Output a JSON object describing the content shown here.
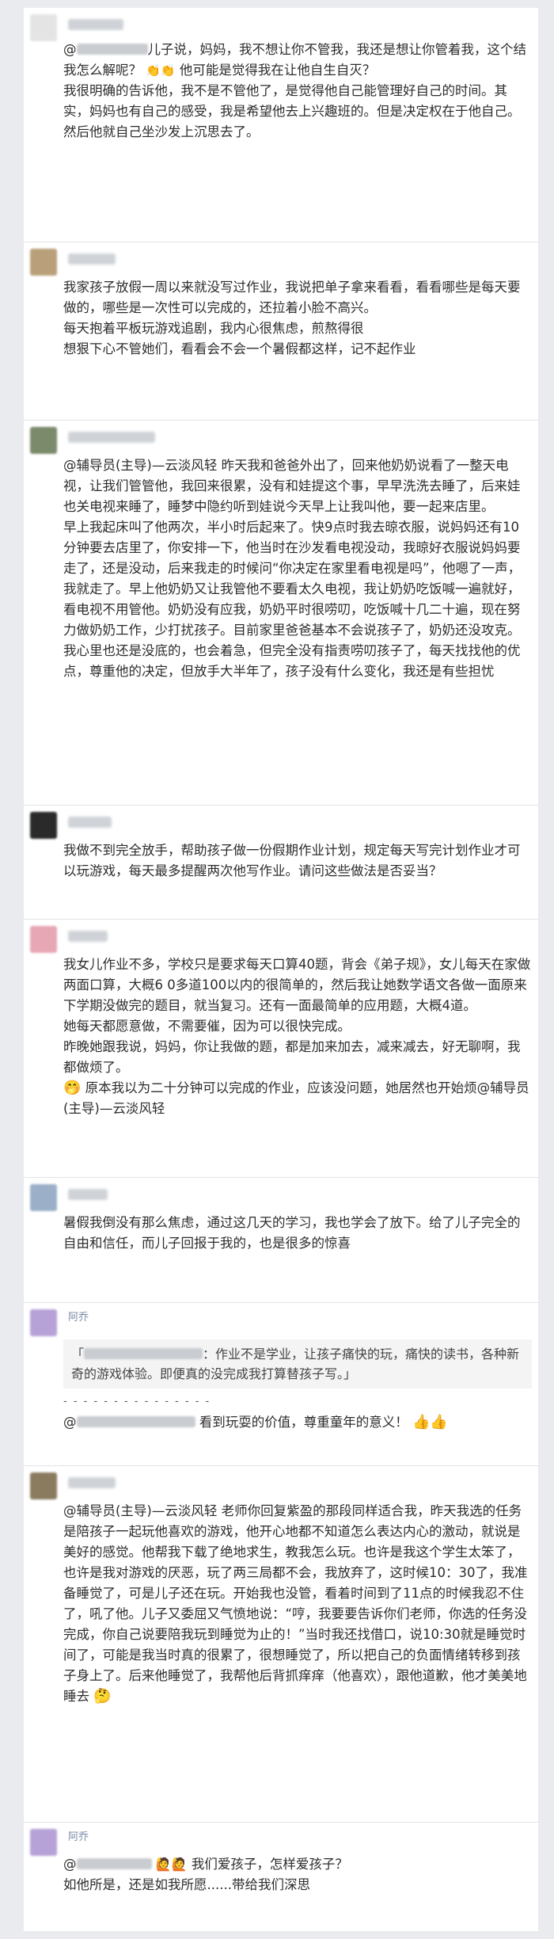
{
  "posts": [
    {
      "avatar_color": "#e4e4e4",
      "paragraphs": [
        "儿子说，妈妈，我不想让你不管我，我还是想让你管着我，这个结我怎么解呢？",
        "他可能是觉得我在让他自生自灭？",
        "我很明确的告诉他，我不是不管他了，是觉得他自己能管理好自己的时间。其实，妈妈也有自己的感受，我是希望他去上兴趣班的。但是决定权在于他自己。",
        "然后他就自己坐沙发上沉思去了。"
      ]
    },
    {
      "avatar_color": "#b9a07a",
      "paragraphs": [
        "我家孩子放假一周以来就没写过作业，我说把单子拿来看看，看看哪些是每天要做的，哪些是一次性可以完成的，还拉着小脸不高兴。",
        "每天抱着平板玩游戏追剧，我内心很焦虑，煎熬得很",
        "想狠下心不管她们，看看会不会一个暑假都这样，记不起作业"
      ]
    },
    {
      "avatar_color": "#7a8a6a",
      "paragraphs": [
        "@辅导员(主导)—云淡风轻 昨天我和爸爸外出了，回来他奶奶说看了一整天电视，让我们管管他，我回来很累，没有和娃提这个事，早早洗洗去睡了，后来娃也关电视来睡了，睡梦中隐约听到娃说今天早上让我叫他，要一起来店里。",
        "早上我起床叫了他两次，半小时后起来了。快9点时我去晾衣服，说妈妈还有10分钟要去店里了，你安排一下，他当时在沙发看电视没动，我晾好衣服说妈妈要走了，还是没动，后来我走的时候问“你决定在家里看电视是吗”，他嗯了一声，我就走了。早上他奶奶又让我管他不要看太久电视，我让奶奶吃饭喊一遍就好，看电视不用管他。奶奶没有应我，奶奶平时很唠叨，吃饭喊十几二十遍，现在努力做奶奶工作，少打扰孩子。目前家里爸爸基本不会说孩子了，奶奶还没攻克。",
        "我心里也还是没底的，也会着急，但完全没有指责唠叨孩子了，每天找找他的优点，尊重他的决定，但放手大半年了，孩子没有什么变化，我还是有些担忧"
      ]
    },
    {
      "avatar_color": "#2a2a2a",
      "paragraphs": [
        "我做不到完全放手，帮助孩子做一份假期作业计划，规定每天写完计划作业才可以玩游戏，每天最多提醒两次他写作业。请问这些做法是否妥当？"
      ]
    },
    {
      "avatar_color": "#e7a7b4",
      "paragraphs": [
        "我女儿作业不多，学校只是要求每天口算40题，背会《弟子规》，女儿每天在家做两面口算，大概6 0多道100以内的很简单的，然后我让她数学语文各做一面原来下学期没做完的题目，就当复习。还有一面最简单的应用题，大概4道。",
        "她每天都愿意做，不需要催，因为可以很快完成。",
        "昨晚她跟我说，妈妈，你让我做的题，都是加来加去，减来减去，好无聊啊，我都做烦了。",
        "原本我以为二十分钟可以完成的作业，应该没问题，她居然也开始烦@辅导员(主导)—云淡风轻"
      ]
    },
    {
      "avatar_color": "#9bb0c8",
      "paragraphs": [
        "暑假我倒没有那么焦虑，通过这几天的学习，我也学会了放下。给了儿子完全的自由和信任，而儿子回报于我的，也是很多的惊喜"
      ]
    },
    {
      "avatar_color": "#b7a2d8",
      "name": "阿乔",
      "quote": "：作业不是学业，让孩子痛快的玩，痛快的读书，各种新奇的游戏体验。即便真的没完成我打算替孩子写。」",
      "dashes": "- - - - - - - - - - - - - - -",
      "reply": "看到玩耍的价值，尊重童年的意义！"
    },
    {
      "avatar_color": "#8a7a5e",
      "paragraphs": [
        "@辅导员(主导)—云淡风轻 老师你回复紫盈的那段同样适合我，昨天我选的任务是陪孩子一起玩他喜欢的游戏，他开心地都不知道怎么表达内心的激动，就说是美好的感觉。他帮我下载了绝地求生，教我怎么玩。也许是我这个学生太笨了，也许是我对游戏的厌恶，玩了两三局都不会，我放弃了，这时候10：30了，我准备睡觉了，可是儿子还在玩。开始我也没管，看着时间到了11点的时候我忍不住了，吼了他。儿子又委屈又气愤地说：“哼，我要要告诉你们老师，你选的任务没完成，你自己说要陪我玩到睡觉为止的！”当时我还找借口，说10:30就是睡觉时间了，可能是我当时真的很累了，很想睡觉了，所以把自己的负面情绪转移到孩子身上了。后来他睡觉了，我帮他后背抓痒痒（他喜欢），跟他道歉，他才美美地睡去"
      ]
    },
    {
      "avatar_color": "#b7a2d8",
      "name": "阿乔",
      "line1": "我们爱孩子，怎样爱孩子？",
      "line2": "如他所是，还是如我所愿......带给我们深思"
    }
  ],
  "icons": {
    "clap": "clapping-hands-icon",
    "thumb": "thumbs-up-icon",
    "cover_face": "cover-mouth-emoji-icon",
    "tongue_face": "tongue-face-emoji-icon",
    "person": "person-emoji-icon"
  }
}
